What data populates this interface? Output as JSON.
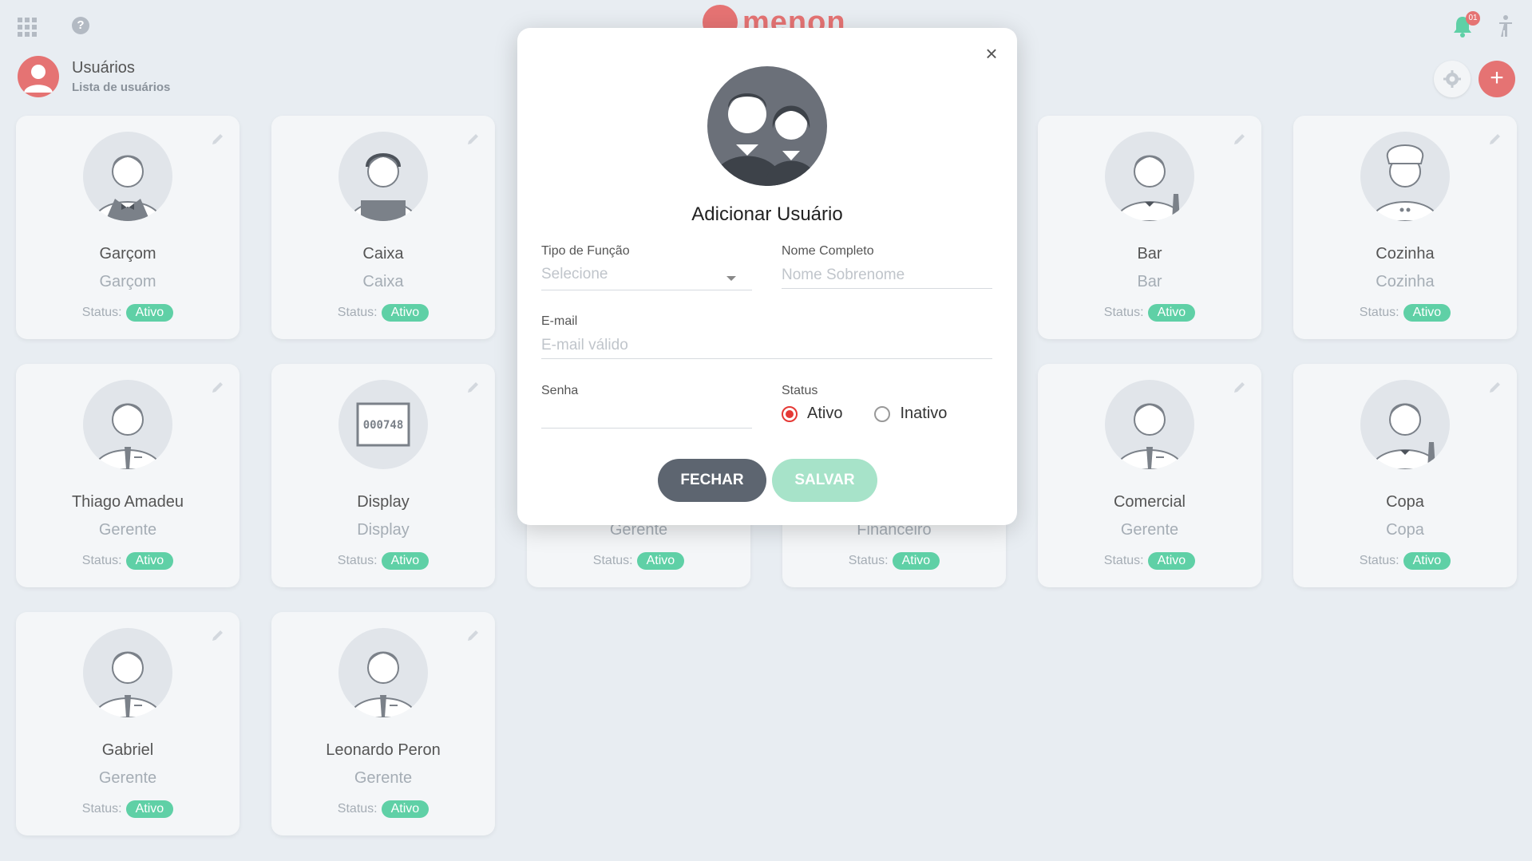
{
  "topbar": {
    "brand": "menon",
    "notification_count": "01"
  },
  "header": {
    "title": "Usuários",
    "subtitle": "Lista de usuários"
  },
  "cards": [
    {
      "name": "Garçom",
      "role": "Garçom",
      "status_label": "Status:",
      "status": "Ativo",
      "avatar": "waiter"
    },
    {
      "name": "Caixa",
      "role": "Caixa",
      "status_label": "Status:",
      "status": "Ativo",
      "avatar": "cashier"
    },
    {
      "name": "Bar",
      "role": "Bar",
      "status_label": "Status:",
      "status": "Ativo",
      "avatar": "bartender"
    },
    {
      "name": "Cozinha",
      "role": "Cozinha",
      "status_label": "Status:",
      "status": "Ativo",
      "avatar": "chef"
    },
    {
      "name": "Thiago Amadeu",
      "role": "Gerente",
      "status_label": "Status:",
      "status": "Ativo",
      "avatar": "manager"
    },
    {
      "name": "Display",
      "role": "Display",
      "status_label": "Status:",
      "status": "Ativo",
      "avatar": "display",
      "display_code": "000748"
    },
    {
      "name": "",
      "role": "Gerente",
      "status_label": "Status:",
      "status": "Ativo",
      "avatar": "manager"
    },
    {
      "name": "",
      "role": "Financeiro",
      "status_label": "Status:",
      "status": "Ativo",
      "avatar": "manager"
    },
    {
      "name": "Comercial",
      "role": "Gerente",
      "status_label": "Status:",
      "status": "Ativo",
      "avatar": "manager"
    },
    {
      "name": "Copa",
      "role": "Copa",
      "status_label": "Status:",
      "status": "Ativo",
      "avatar": "bartender"
    },
    {
      "name": "Gabriel",
      "role": "Gerente",
      "status_label": "Status:",
      "status": "Ativo",
      "avatar": "manager"
    },
    {
      "name": "Leonardo Peron",
      "role": "Gerente",
      "status_label": "Status:",
      "status": "Ativo",
      "avatar": "manager"
    }
  ],
  "modal": {
    "title": "Adicionar Usuário",
    "role_label": "Tipo de Função",
    "role_placeholder": "Selecione",
    "name_label": "Nome Completo",
    "name_placeholder": "Nome Sobrenome",
    "email_label": "E-mail",
    "email_placeholder": "E-mail válido",
    "password_label": "Senha",
    "status_label": "Status",
    "status_active": "Ativo",
    "status_inactive": "Inativo",
    "close_button": "FECHAR",
    "save_button": "SALVAR"
  },
  "colors": {
    "accent": "#e57373",
    "active_badge": "#5fd0a6",
    "close_button": "#5d6570",
    "save_button": "#a7e3c9"
  }
}
